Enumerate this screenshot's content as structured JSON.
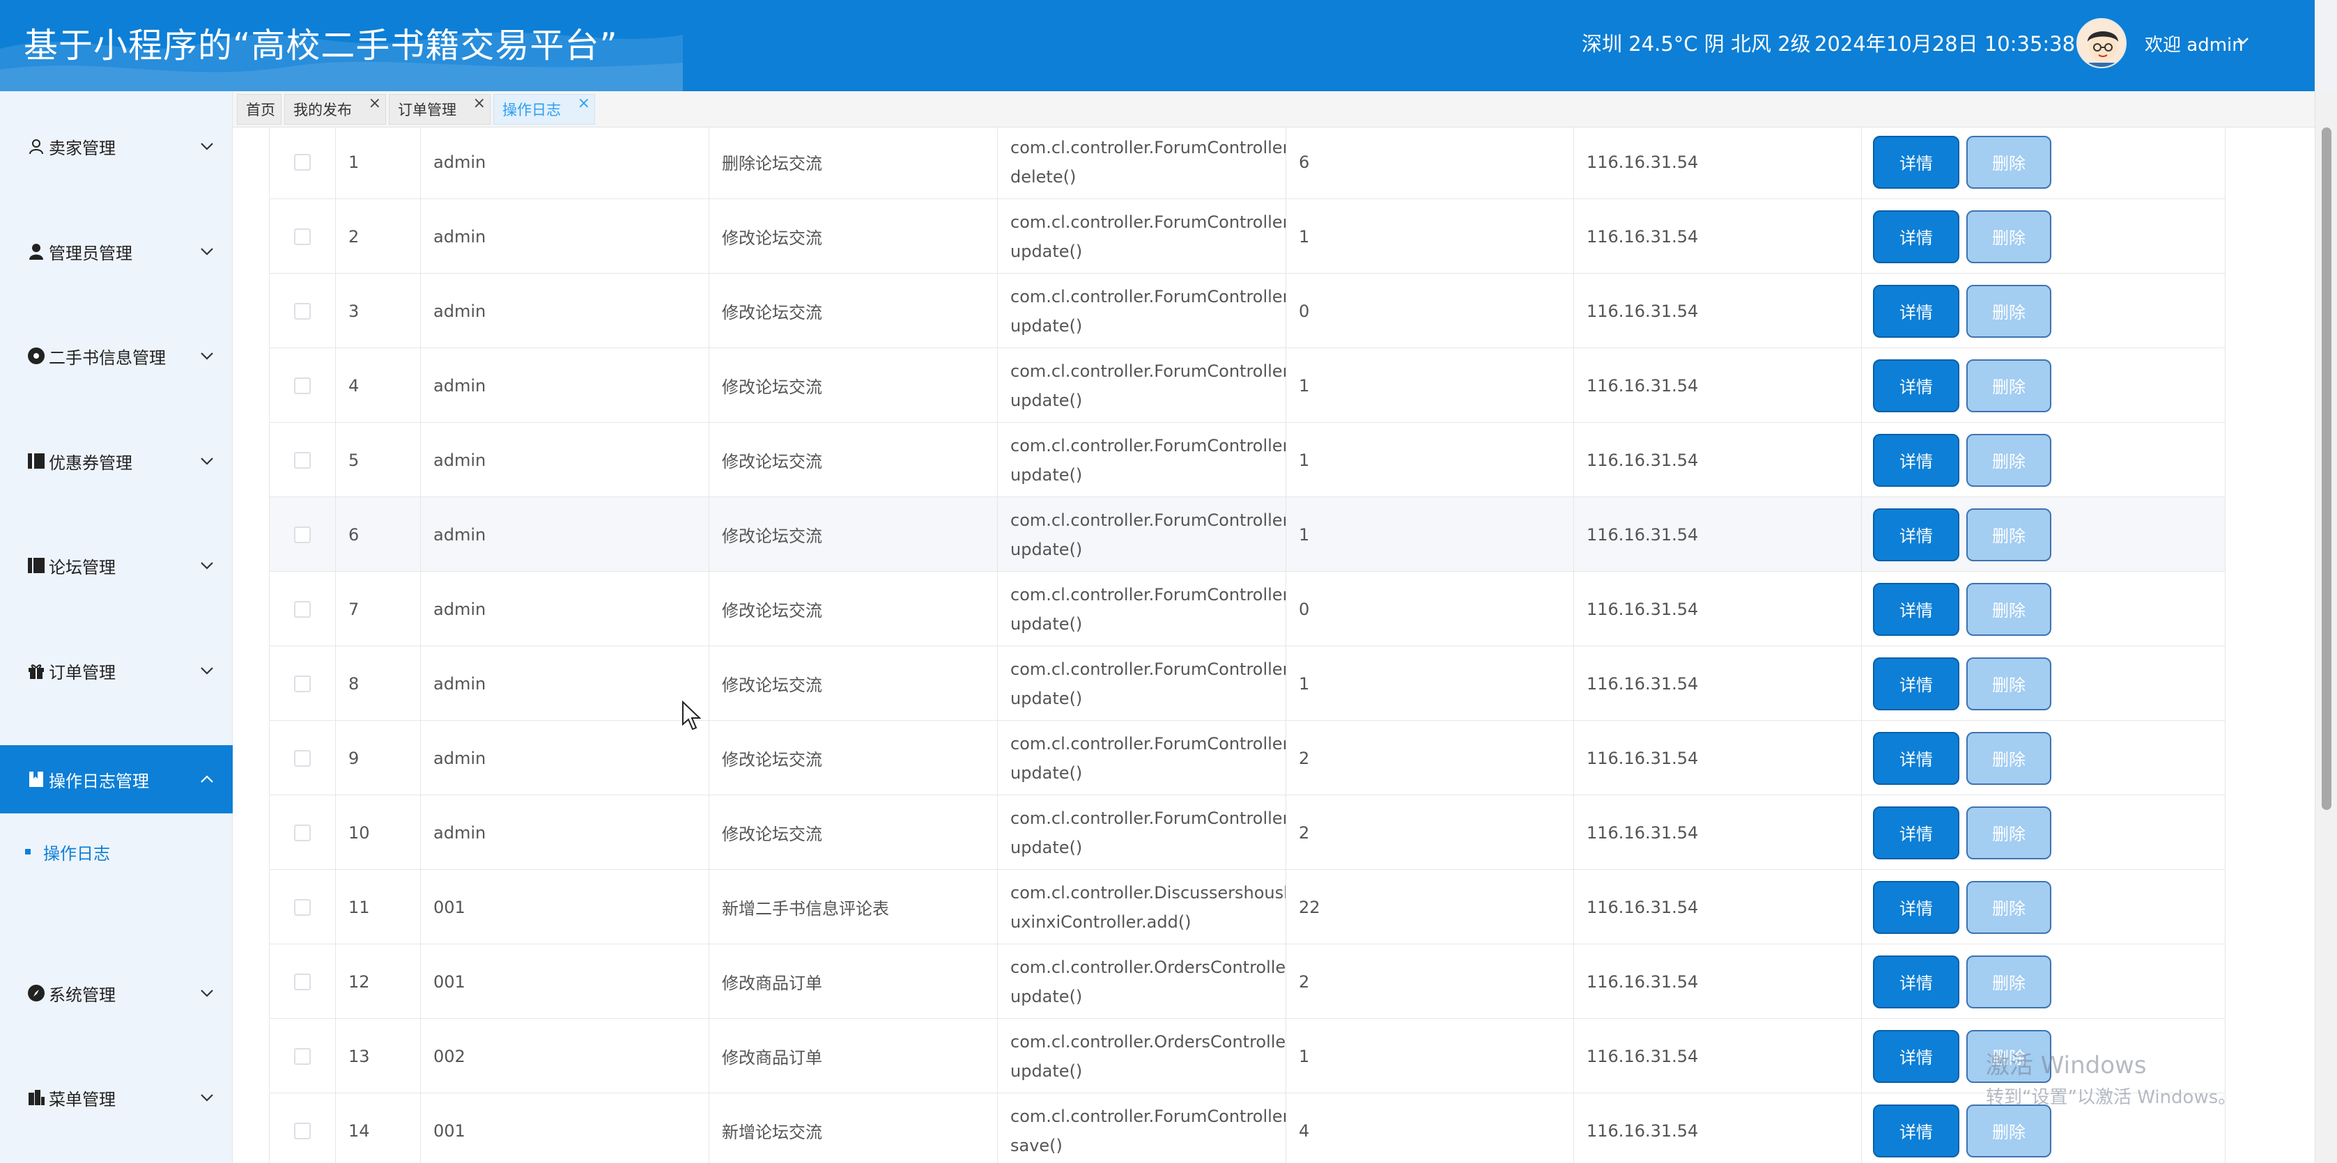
{
  "header": {
    "title": "基于小程序的“高校二手书籍交易平台”",
    "weather": "深圳 24.5°C 阴 北风 2级",
    "datetime": "2024年10月28日 10:35:38",
    "welcome": "欢迎 admin"
  },
  "sidebar": {
    "items": [
      {
        "label": "卖家管理",
        "icon": "user-icon"
      },
      {
        "label": "管理员管理",
        "icon": "admin-user-icon"
      },
      {
        "label": "二手书信息管理",
        "icon": "info-circle-icon"
      },
      {
        "label": "优惠券管理",
        "icon": "coupon-icon"
      },
      {
        "label": "论坛管理",
        "icon": "forum-book-icon"
      },
      {
        "label": "订单管理",
        "icon": "gift-box-icon"
      },
      {
        "label": "操作日志管理",
        "icon": "log-book-icon"
      },
      {
        "label": "系统管理",
        "icon": "compass-icon"
      },
      {
        "label": "菜单管理",
        "icon": "menu-building-icon"
      }
    ],
    "submenu": {
      "label": "操作日志"
    }
  },
  "tabs": [
    {
      "label": "首页",
      "closable": false
    },
    {
      "label": "我的发布",
      "closable": true
    },
    {
      "label": "订单管理",
      "closable": true
    },
    {
      "label": "操作日志",
      "closable": true,
      "active": true
    }
  ],
  "table": {
    "detail_label": "详情",
    "delete_label": "删除",
    "rows": [
      {
        "id": "1",
        "user": "admin",
        "op": "删除论坛交流",
        "method1": "com.cl.controller.ForumController.",
        "method2": "delete()",
        "params": "6",
        "ip": "116.16.31.54"
      },
      {
        "id": "2",
        "user": "admin",
        "op": "修改论坛交流",
        "method1": "com.cl.controller.ForumController.",
        "method2": "update()",
        "params": "1",
        "ip": "116.16.31.54"
      },
      {
        "id": "3",
        "user": "admin",
        "op": "修改论坛交流",
        "method1": "com.cl.controller.ForumController.",
        "method2": "update()",
        "params": "0",
        "ip": "116.16.31.54"
      },
      {
        "id": "4",
        "user": "admin",
        "op": "修改论坛交流",
        "method1": "com.cl.controller.ForumController.",
        "method2": "update()",
        "params": "1",
        "ip": "116.16.31.54"
      },
      {
        "id": "5",
        "user": "admin",
        "op": "修改论坛交流",
        "method1": "com.cl.controller.ForumController.",
        "method2": "update()",
        "params": "1",
        "ip": "116.16.31.54"
      },
      {
        "id": "6",
        "user": "admin",
        "op": "修改论坛交流",
        "method1": "com.cl.controller.ForumController.",
        "method2": "update()",
        "params": "1",
        "ip": "116.16.31.54"
      },
      {
        "id": "7",
        "user": "admin",
        "op": "修改论坛交流",
        "method1": "com.cl.controller.ForumController.",
        "method2": "update()",
        "params": "0",
        "ip": "116.16.31.54"
      },
      {
        "id": "8",
        "user": "admin",
        "op": "修改论坛交流",
        "method1": "com.cl.controller.ForumController.",
        "method2": "update()",
        "params": "1",
        "ip": "116.16.31.54"
      },
      {
        "id": "9",
        "user": "admin",
        "op": "修改论坛交流",
        "method1": "com.cl.controller.ForumController.",
        "method2": "update()",
        "params": "2",
        "ip": "116.16.31.54"
      },
      {
        "id": "10",
        "user": "admin",
        "op": "修改论坛交流",
        "method1": "com.cl.controller.ForumController.",
        "method2": "update()",
        "params": "2",
        "ip": "116.16.31.54"
      },
      {
        "id": "11",
        "user": "001",
        "op": "新增二手书信息评论表",
        "method1": "com.cl.controller.Discussershoush",
        "method2": "uxinxiController.add()",
        "params": "22",
        "ip": "116.16.31.54"
      },
      {
        "id": "12",
        "user": "001",
        "op": "修改商品订单",
        "method1": "com.cl.controller.OrdersController.",
        "method2": "update()",
        "params": "2",
        "ip": "116.16.31.54"
      },
      {
        "id": "13",
        "user": "002",
        "op": "修改商品订单",
        "method1": "com.cl.controller.OrdersController.",
        "method2": "update()",
        "params": "1",
        "ip": "116.16.31.54"
      },
      {
        "id": "14",
        "user": "001",
        "op": "新增论坛交流",
        "method1": "com.cl.controller.ForumController.",
        "method2": "save()",
        "params": "4",
        "ip": "116.16.31.54"
      }
    ]
  },
  "watermark": {
    "line1": "激活 Windows",
    "line2": "转到“设置”以激活 Windows。"
  },
  "colors": {
    "primary": "#0d7fd6",
    "delete_button": "#a3cdf1",
    "active_tab_text": "#2aa0f2"
  }
}
